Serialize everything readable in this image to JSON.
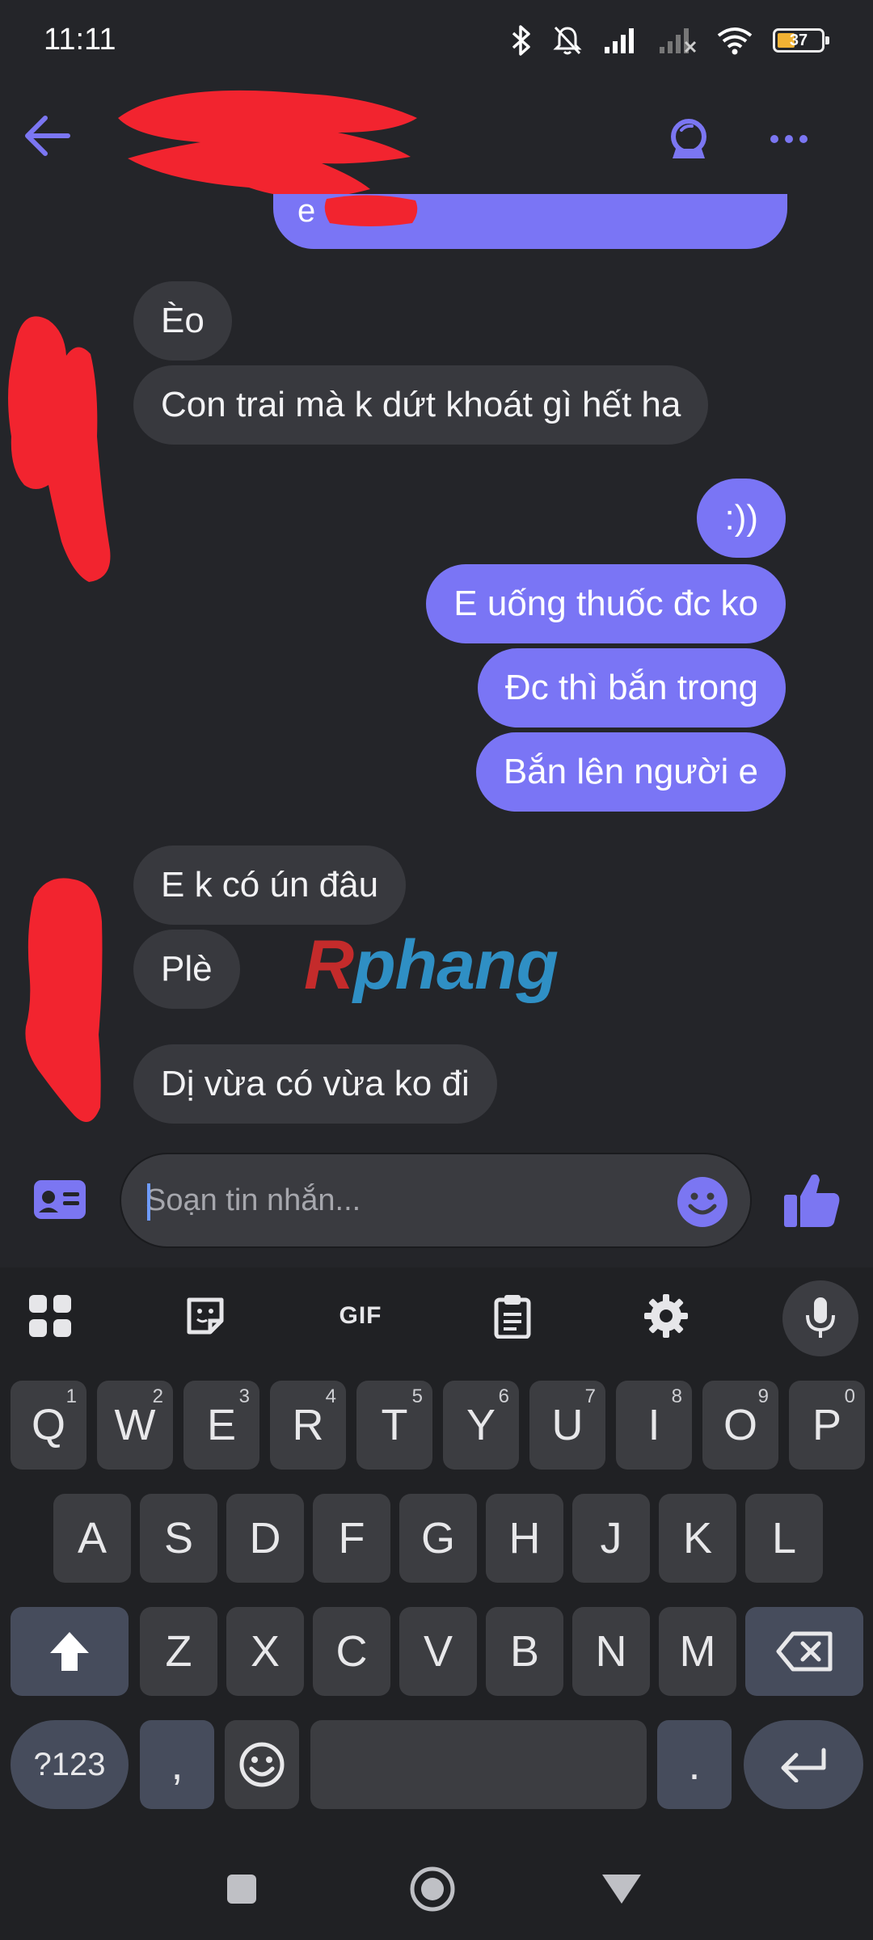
{
  "status_bar": {
    "time": "11:11",
    "battery_level": "37"
  },
  "header": {
    "back_icon": "arrow-left-icon",
    "contact_name_redacted": true,
    "globe_icon": "globe-icon",
    "more_icon": "more-horizontal-icon"
  },
  "messages": {
    "top_partial_text": "e",
    "items": [
      {
        "direction": "in",
        "text": "Èo"
      },
      {
        "direction": "in",
        "text": "Con trai mà k dứt khoát gì hết ha"
      },
      {
        "direction": "out",
        "text": ":))"
      },
      {
        "direction": "out",
        "text": "E uống thuốc đc ko"
      },
      {
        "direction": "out",
        "text": "Đc thì bắn trong"
      },
      {
        "direction": "out",
        "text": "Bắn lên người e"
      },
      {
        "direction": "in",
        "text": "E k có ún đâu"
      },
      {
        "direction": "in",
        "text": "Plè"
      },
      {
        "direction": "in",
        "text": "Dị vừa có vừa ko đi"
      }
    ]
  },
  "watermark": {
    "first": "R",
    "rest": "phang"
  },
  "composer": {
    "placeholder": "Soạn tin nhắn...",
    "value": "",
    "left_icon": "contact-card-icon",
    "emoji_icon": "smiley-icon",
    "send_icon": "thumbs-up-icon"
  },
  "keyboard": {
    "toolbar": [
      "apps-grid-icon",
      "sticker-icon",
      "GIF",
      "clipboard-icon",
      "settings-gear-icon",
      "microphone-icon"
    ],
    "row1": [
      {
        "key": "Q",
        "hint": "1"
      },
      {
        "key": "W",
        "hint": "2"
      },
      {
        "key": "E",
        "hint": "3"
      },
      {
        "key": "R",
        "hint": "4"
      },
      {
        "key": "T",
        "hint": "5"
      },
      {
        "key": "Y",
        "hint": "6"
      },
      {
        "key": "U",
        "hint": "7"
      },
      {
        "key": "I",
        "hint": "8"
      },
      {
        "key": "O",
        "hint": "9"
      },
      {
        "key": "P",
        "hint": "0"
      }
    ],
    "row2": [
      "A",
      "S",
      "D",
      "F",
      "G",
      "H",
      "J",
      "K",
      "L"
    ],
    "row3": [
      "Z",
      "X",
      "C",
      "V",
      "B",
      "N",
      "M"
    ],
    "symbols_label": "?123",
    "comma": ",",
    "period": "."
  },
  "colors": {
    "background": "#242529",
    "outgoing_bubble": "#7a75f5",
    "incoming_bubble": "#38393e",
    "accent": "#7b76f2",
    "redaction": "#f2242f"
  },
  "navbar": [
    "recents-square-icon",
    "home-circle-icon",
    "back-triangle-icon"
  ]
}
